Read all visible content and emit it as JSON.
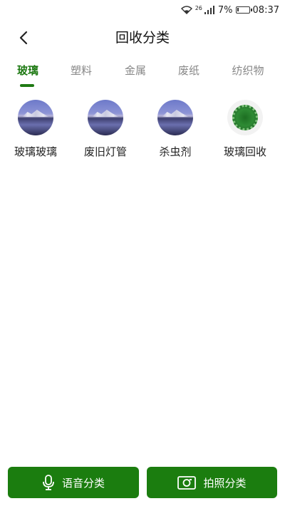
{
  "status_bar": {
    "network_label": "26",
    "battery": "7%",
    "time": "08:37"
  },
  "header": {
    "title": "回收分类"
  },
  "tabs": [
    {
      "label": "玻璃",
      "active": true
    },
    {
      "label": "塑料",
      "active": false
    },
    {
      "label": "金属",
      "active": false
    },
    {
      "label": "废纸",
      "active": false
    },
    {
      "label": "纺织物",
      "active": false
    }
  ],
  "items": [
    {
      "label": "玻璃玻璃",
      "thumb": "landscape-image"
    },
    {
      "label": "废旧灯管",
      "thumb": "landscape-image"
    },
    {
      "label": "杀虫剂",
      "thumb": "landscape-image"
    },
    {
      "label": "玻璃回收",
      "thumb": "green-badge-image"
    }
  ],
  "actions": {
    "voice_label": "语音分类",
    "voice_icon": "microphone-icon",
    "photo_label": "拍照分类",
    "photo_icon": "camera-icon"
  },
  "colors": {
    "accent": "#1f7a14",
    "button_bg": "#1b7d0f"
  }
}
